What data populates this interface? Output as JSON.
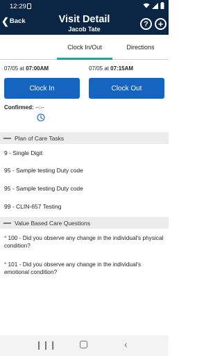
{
  "status_bar": {
    "time": "12:29",
    "icons": [
      "wifi-icon",
      "signal-icon",
      "battery-icon"
    ]
  },
  "header": {
    "back_label": "Back",
    "title": "Visit Detail",
    "subtitle": "Jacob Tate",
    "help_glyph": "?",
    "add_glyph": "+"
  },
  "tabs": [
    {
      "label": "Clock In/Out",
      "active": true
    },
    {
      "label": "Directions",
      "active": false
    }
  ],
  "clock": {
    "in_date": "07/05 at ",
    "in_time": "07:00AM",
    "out_date": "07/05 at ",
    "out_time": "07:15AM",
    "clock_in_label": "Clock In",
    "clock_out_label": "Clock Out",
    "confirmed_label": "Confirmed:",
    "confirmed_value": "--:--"
  },
  "plan_of_care": {
    "title": "Plan of Care Tasks",
    "tasks": [
      "9 - Single Digit",
      "95 - Sample testing Duty code",
      "95 - Sample testing Duty code",
      "99 - CLIN-657 Testing"
    ]
  },
  "value_based_care": {
    "title": "Value Based Care Questions",
    "questions": [
      {
        "required": "*",
        "text": " 100 -  Did you observe any change in the individual's physical condition?"
      },
      {
        "required": "*",
        "text": " 101 -  Did you observe any change in the individual's emotional condition?"
      }
    ]
  },
  "colors": {
    "header_bg": "#0b2545",
    "button_bg": "#1565c0",
    "tab_accent": "#1aa6a0",
    "required": "#d32f2f"
  }
}
